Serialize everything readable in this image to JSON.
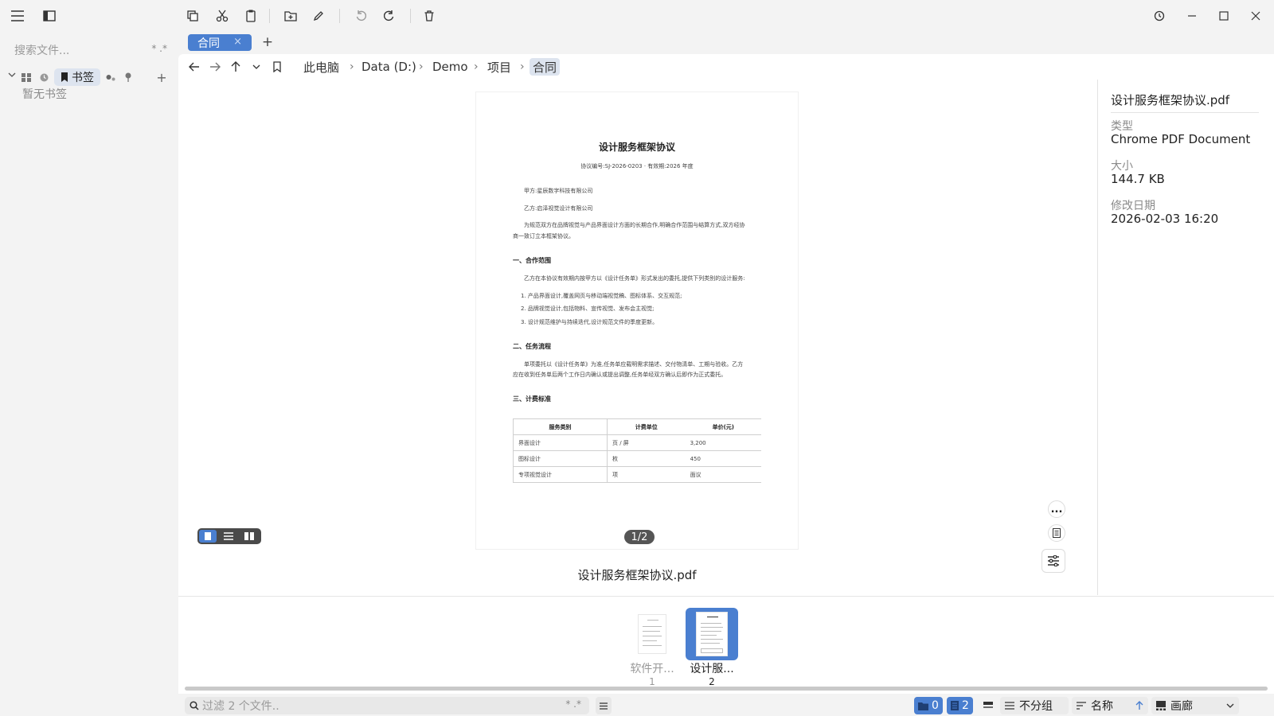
{
  "toolbar": {
    "icons": [
      "menu-icon",
      "sidebar-toggle-icon",
      "copy-icon",
      "cut-icon",
      "paste-icon",
      "new-folder-icon",
      "rename-icon",
      "undo-icon",
      "redo-icon",
      "delete-icon",
      "history-icon",
      "minimize-icon",
      "maximize-icon",
      "close-icon"
    ]
  },
  "sidebar": {
    "search_placeholder": "搜索文件...",
    "search_wildcard": "* .*",
    "bookmarks_label": "书签",
    "empty_text": "暂无书签",
    "add": "+"
  },
  "tabs": [
    {
      "label": "合同",
      "close": "×"
    }
  ],
  "tab_add": "+",
  "breadcrumb": [
    "此电脑",
    "Data (D:)",
    "Demo",
    "项目",
    "合同"
  ],
  "preview": {
    "doc_title": "设计服务框架协议",
    "doc_meta": "协议编号:SJ-2026-0203 · 有效期:2026 年度",
    "party_a": "甲方:星辰数字科技有限公司",
    "party_b": "乙方:启泽视觉设计有限公司",
    "intro_1": "为规范双方在品牌视觉与产品界面设计方面的长期合作,明确合作范围与结算方式,双方经协",
    "intro_2": "商一致订立本框架协议。",
    "section_1": "一、合作范围",
    "section_1_text": "乙方在本协议有效期内按甲方以《设计任务单》形式发出的委托,提供下列类别的设计服务:",
    "item_1": "1. 产品界面设计,覆盖网页与移动端视觉稿、图标体系、交互规范;",
    "item_2": "2. 品牌视觉设计,包括物料、宣传视觉、发布会主视觉;",
    "item_3": "3. 设计规范维护与持续迭代,设计规范文件的季度更新。",
    "section_2": "二、任务流程",
    "section_2_text_1": "单项委托以《设计任务单》为准,任务单应载明需求描述、交付物清单、工期与验收。乙方",
    "section_2_text_2": "应在收到任务单后两个工作日内确认或提出调整,任务单经双方确认后即作为正式委托。",
    "section_3": "三、计费标准",
    "table": {
      "headers": [
        "服务类别",
        "计费单位",
        "单价(元)"
      ],
      "rows": [
        [
          "界面设计",
          "页 / 屏",
          "3,200"
        ],
        [
          "图标设计",
          "枚",
          "450"
        ],
        [
          "专项视觉设计",
          "项",
          "面议"
        ]
      ]
    },
    "page_indicator": "1/2",
    "filename": "设计服务框架协议.pdf",
    "more_label": "..."
  },
  "info": {
    "filename": "设计服务框架协议.pdf",
    "type_label": "类型",
    "type_value": "Chrome PDF Document",
    "size_label": "大小",
    "size_value": "144.7 KB",
    "modified_label": "修改日期",
    "modified_value": "2026-02-03 16:20"
  },
  "thumbnails": [
    {
      "name": "软件开...",
      "index": "1",
      "selected": false
    },
    {
      "name": "设计服...",
      "index": "2",
      "selected": true
    }
  ],
  "statusbar": {
    "filter_placeholder": "过滤 2 个文件..",
    "filter_wildcard": "* .*",
    "folders_count": "0",
    "files_count": "2",
    "group_label": "不分组",
    "sort_label": "名称",
    "view_label": "画廊"
  },
  "colors": {
    "accent": "#4a7fd0",
    "background": "#f3f3f3",
    "panel": "#ffffff"
  }
}
